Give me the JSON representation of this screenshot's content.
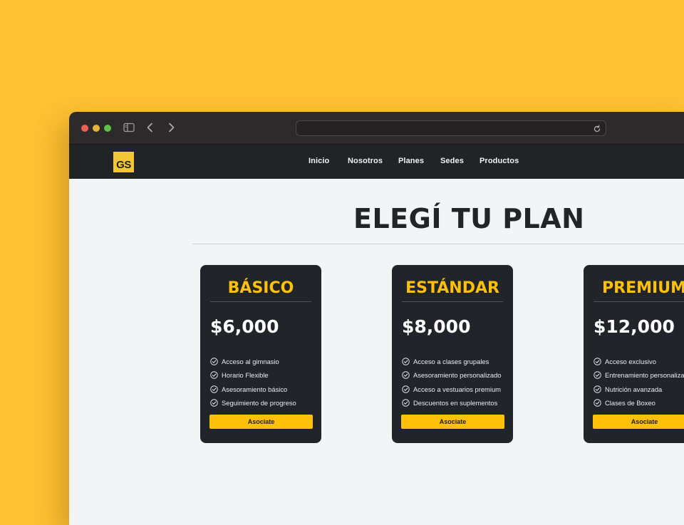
{
  "browser": {
    "url": ""
  },
  "site": {
    "logo": "GS",
    "nav": [
      "Inicio",
      "Nosotros",
      "Planes",
      "Sedes",
      "Productos"
    ]
  },
  "page": {
    "title": "ELEGÍ TU PLAN"
  },
  "plans": [
    {
      "name": "BÁSICO",
      "price": "$6,000",
      "features": [
        "Acceso al gimnasio",
        "Horario Flexible",
        "Asesoramiento básico",
        "Seguimiento de progreso"
      ],
      "button": "Asociate"
    },
    {
      "name": "ESTÁNDAR",
      "price": "$8,000",
      "features": [
        "Acceso a clases grupales",
        "Asesoramiento personalizado",
        "Acceso a vestuarios premium",
        "Descuentos en suplementos"
      ],
      "button": "Asociate"
    },
    {
      "name": "PREMIUM",
      "price": "$12,000",
      "features": [
        "Acceso exclusivo",
        "Entrenamiento personalizado",
        "Nutrición avanzada",
        "Clases de Boxeo"
      ],
      "button": "Asociate"
    }
  ],
  "colors": {
    "background": "#FFC233",
    "navbar": "#202427",
    "card": "#212529",
    "accent": "#FFC107",
    "page": "#F3F4F6"
  }
}
